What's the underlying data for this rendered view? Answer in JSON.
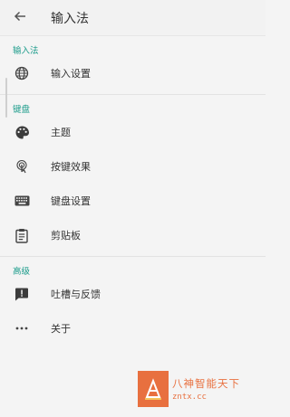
{
  "appbar": {
    "title": "输入法",
    "back_icon": "arrow-left-icon"
  },
  "sections": {
    "ime": {
      "header": "输入法",
      "items": [
        {
          "label": "输入设置",
          "icon": "globe-icon"
        }
      ]
    },
    "keyboard": {
      "header": "键盘",
      "items": [
        {
          "label": "主题",
          "icon": "palette-icon"
        },
        {
          "label": "按键效果",
          "icon": "touch-icon"
        },
        {
          "label": "键盘设置",
          "icon": "keyboard-icon"
        },
        {
          "label": "剪贴板",
          "icon": "clipboard-icon"
        }
      ]
    },
    "advanced": {
      "header": "高级",
      "items": [
        {
          "label": "吐槽与反馈",
          "icon": "feedback-icon"
        },
        {
          "label": "关于",
          "icon": "more-icon"
        }
      ]
    }
  },
  "watermark": {
    "title": "八神智能天下",
    "url": "zntx.cc"
  },
  "colors": {
    "accent": "#1a9b8a",
    "watermark": "#e8703f"
  }
}
